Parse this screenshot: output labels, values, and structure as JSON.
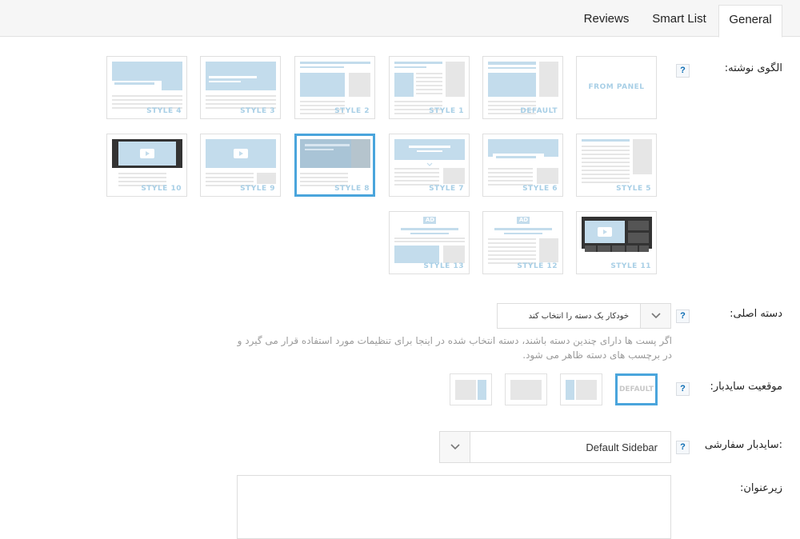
{
  "tabs": [
    {
      "label": "Reviews",
      "active": false
    },
    {
      "label": "Smart List",
      "active": false
    },
    {
      "label": "General",
      "active": true
    }
  ],
  "post_template": {
    "label": "الگوی نوشته:",
    "help": "?",
    "styles": [
      {
        "caption": "FROM PANEL",
        "selected": false
      },
      {
        "caption": "DEFAULT",
        "selected": false
      },
      {
        "caption": "STYLE 1",
        "selected": false
      },
      {
        "caption": "STYLE 2",
        "selected": false
      },
      {
        "caption": "STYLE 3",
        "selected": false
      },
      {
        "caption": "STYLE 4",
        "selected": false
      },
      {
        "caption": "STYLE 5",
        "selected": false
      },
      {
        "caption": "STYLE 6",
        "selected": false
      },
      {
        "caption": "STYLE 7",
        "selected": false
      },
      {
        "caption": "STYLE 8",
        "selected": true
      },
      {
        "caption": "STYLE 9",
        "selected": false
      },
      {
        "caption": "STYLE 10",
        "selected": false
      },
      {
        "caption": "STYLE 11",
        "selected": false
      },
      {
        "caption": "STYLE 12",
        "ad_label": "AD",
        "selected": false
      },
      {
        "caption": "STYLE 13",
        "ad_label": "AD",
        "selected": false
      }
    ]
  },
  "main_category": {
    "label": "دسته اصلی:",
    "help": "?",
    "value": "خودکار یک دسته را انتخاب کند",
    "description": "اگر پست ها دارای چندین دسته باشند، دسته انتخاب شده در اینجا برای تنظیمات مورد استفاده قرار می گیرد و در برچسب های دسته ظاهر می شود."
  },
  "sidebar_position": {
    "label": "موقعیت سایدبار:",
    "help": "?",
    "options": [
      {
        "name": "default",
        "text": "DEFAULT",
        "selected": true
      },
      {
        "name": "left",
        "selected": false
      },
      {
        "name": "none",
        "selected": false
      },
      {
        "name": "right",
        "selected": false
      }
    ]
  },
  "custom_sidebar": {
    "label": ":سایدبار سفارشی",
    "help": "?",
    "value": "Default Sidebar"
  },
  "subtitle": {
    "label": "زیرعنوان:",
    "value": ""
  },
  "colors": {
    "accent": "#4aa5dc",
    "thumb_blue": "#c3dcec",
    "thumb_gray": "#e6e6e6",
    "thumb_dark": "#333333"
  }
}
